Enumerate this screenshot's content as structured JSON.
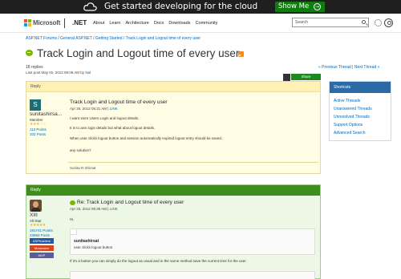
{
  "banner": {
    "text": "Get started developing for the cloud",
    "button": "Show Me",
    "button_icon": "arrow-right-circle-icon",
    "icon": "cloud-icon"
  },
  "nav": {
    "brand": "Microsoft",
    "product": ".NET",
    "links": [
      "About",
      "Learn",
      "Architecture",
      "Docs",
      "Downloads",
      "Community"
    ],
    "search_placeholder": "Search",
    "icons": [
      "search-icon",
      "gear-icon",
      "user-icon"
    ],
    "logo_colors": [
      "#f25022",
      "#7fba00",
      "#00a4ef",
      "#ffb900"
    ]
  },
  "breadcrumb": "ASP.NET Forums / General ASP.NET / Getting Started / Track Login and Logout time of every user",
  "thread": {
    "title": "Track Login and Logout time of every user",
    "replies": "18 replies",
    "last_post_label": "Last post May 02, 2012 09:09 AM by",
    "last_post_user": "Nal",
    "prev_next": "« Previous Thread | Next Thread »"
  },
  "shortcuts": {
    "header": "Shortcuts",
    "links": [
      "Active Threads",
      "Unanswered Threads",
      "Unresolved Threads",
      "Support Options",
      "Advanced Search"
    ]
  },
  "post1": {
    "header": "Reply",
    "share": "Share",
    "avatar_letter": "S",
    "username": "sunitashirsa...",
    "role": "Member",
    "stars": "★★★☆☆",
    "points": "113 Points",
    "posts": "102 Posts",
    "title": "Track Login and Logout time of every user",
    "date": "Apr 26, 2012 05:31 AM",
    "link": "LINK",
    "lines": [
      "I want store Users Login and logout details.",
      "It is to aviv login details but what about logout details.",
      "When user clicks logout button and session automatically expired logout entry should be saved..",
      "any solution?"
    ],
    "signature": "Sunita R Shirsat"
  },
  "post2": {
    "header": "Reply",
    "username": "XIII",
    "role": "All-Star",
    "stars": "★★★★★",
    "points": "191741 Points",
    "posts": "23950 Posts",
    "badges": [
      "ASPInsiders",
      "Moderator",
      "MVP"
    ],
    "title": "Re: Track Login and Logout time of every user",
    "date": "Apr 26, 2012 05:35 AM",
    "link": "LINK",
    "greeting": "Hi,",
    "quote_user": "sunitashirsat",
    "quote_text": "user clicks logout button",
    "reply": "If it's a button you can simply do the logout as usual and in the same method save the current time for the user."
  }
}
